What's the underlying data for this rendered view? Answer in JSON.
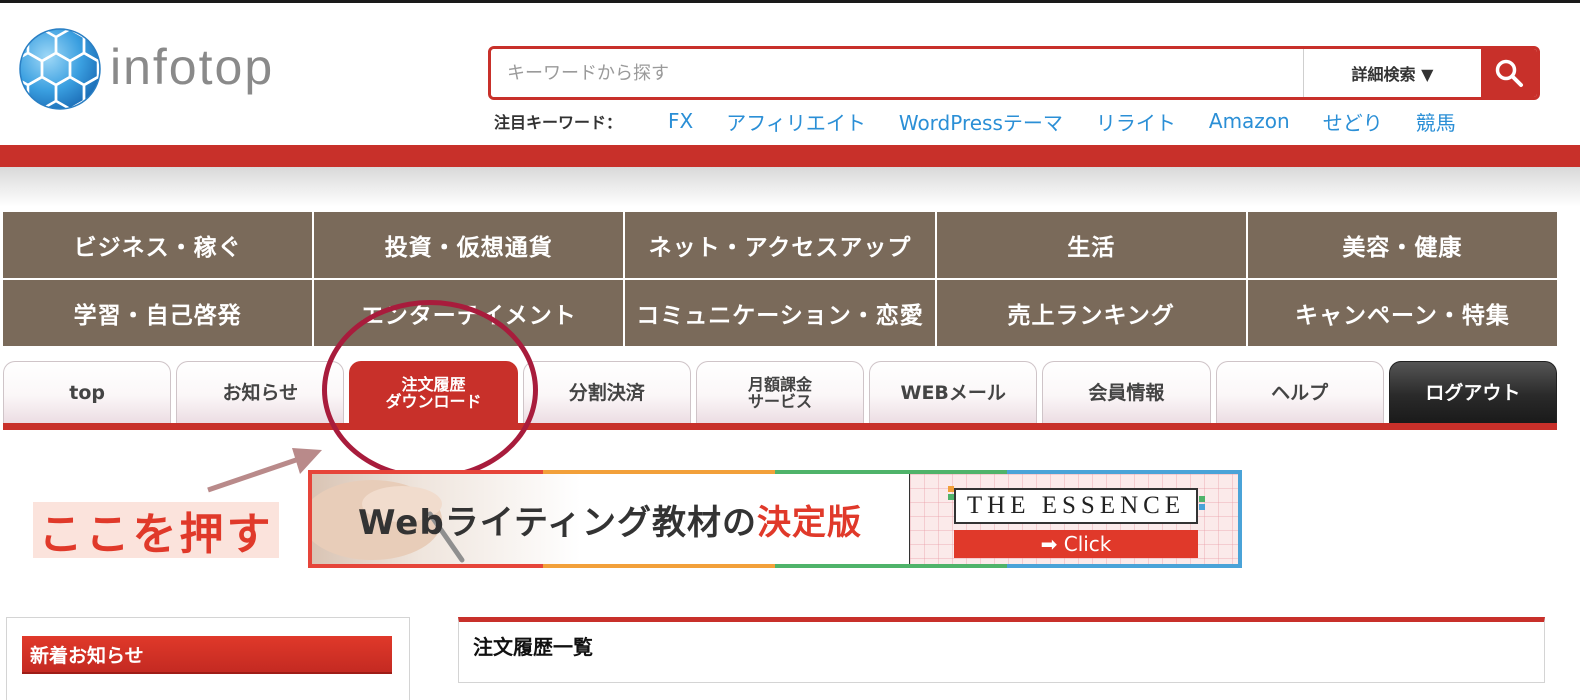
{
  "logo": {
    "text": "infotop"
  },
  "search": {
    "placeholder": "キーワードから探す",
    "advanced_label": "詳細検索 ▼",
    "button_icon": "search-icon"
  },
  "keywords": {
    "label": "注目キーワード：",
    "items": [
      "FX",
      "アフィリエイト",
      "WordPressテーマ",
      "リライト",
      "Amazon",
      "せどり",
      "競馬"
    ]
  },
  "categories": [
    "ビジネス・稼ぐ",
    "投資・仮想通貨",
    "ネット・アクセスアップ",
    "生活",
    "美容・健康",
    "学習・自己啓発",
    "エンターテイメント",
    "コミュニケーション・恋愛",
    "売上ランキング",
    "キャンペーン・特集"
  ],
  "tabs": {
    "top": "top",
    "news": "お知らせ",
    "order_line1": "注文履歴",
    "order_line2": "ダウンロード",
    "installment": "分割決済",
    "monthly_line1": "月額課金",
    "monthly_line2": "サービス",
    "webmail": "WEBメール",
    "member": "会員情報",
    "help": "ヘルプ",
    "logout": "ログアウト"
  },
  "annotation": {
    "label": "ここを押す"
  },
  "banner": {
    "title_part1": "Webライティング教材の",
    "title_part2": "決定版",
    "essence": "THE ESSENCE",
    "click": "➡ Click"
  },
  "sidebar": {
    "heading": "新着お知らせ"
  },
  "main": {
    "heading": "注文履歴一覧"
  },
  "colors": {
    "brand_red": "#c8302a",
    "category_brown": "#7a6a5a",
    "link_blue": "#2b8fd6",
    "annotation_red": "#e0392a"
  }
}
